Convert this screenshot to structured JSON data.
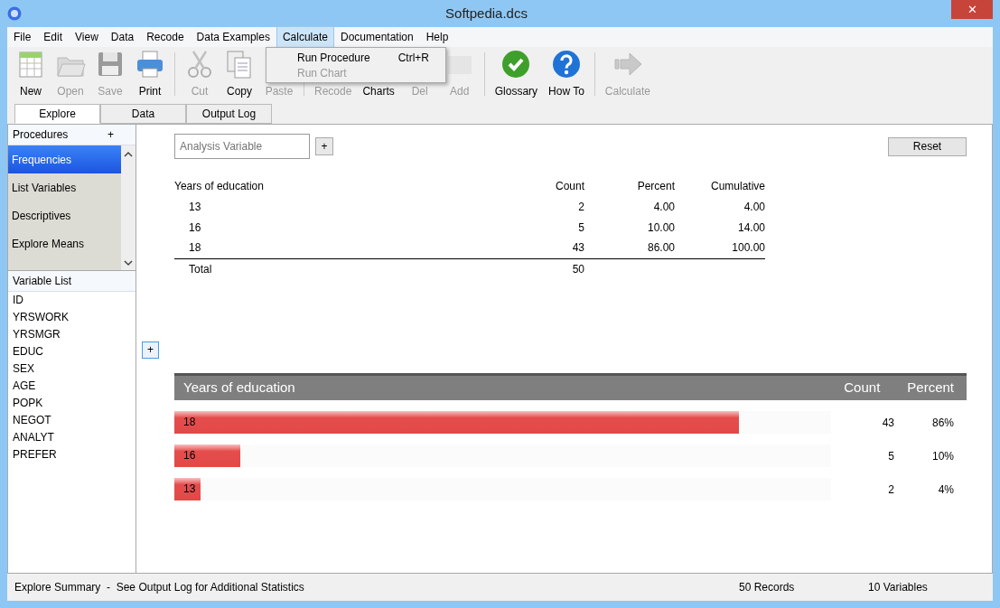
{
  "window": {
    "title": "Softpedia.dcs",
    "close": "✕"
  },
  "menu": [
    {
      "label": "File",
      "selected": false
    },
    {
      "label": "Edit",
      "selected": false
    },
    {
      "label": "View",
      "selected": false
    },
    {
      "label": "Data",
      "selected": false
    },
    {
      "label": "Recode",
      "selected": false
    },
    {
      "label": "Data Examples",
      "selected": false
    },
    {
      "label": "Calculate",
      "selected": true
    },
    {
      "label": "Documentation",
      "selected": false
    },
    {
      "label": "Help",
      "selected": false
    }
  ],
  "dropdown": [
    {
      "label": "Run Procedure",
      "shortcut": "Ctrl+R",
      "disabled": false
    },
    {
      "label": "Run Chart",
      "disabled": true
    }
  ],
  "toolbar": [
    [
      {
        "label": "New",
        "disabled": false
      },
      {
        "label": "Open",
        "disabled": true
      },
      {
        "label": "Save",
        "disabled": true
      },
      {
        "label": "Print",
        "disabled": false
      }
    ],
    [
      {
        "label": "Cut",
        "disabled": true
      },
      {
        "label": "Copy",
        "disabled": false
      },
      {
        "label": "Paste",
        "disabled": true
      }
    ],
    [
      {
        "label": "Recode",
        "disabled": true
      },
      {
        "label": "Charts",
        "disabled": false
      },
      {
        "label": "Del",
        "disabled": true
      },
      {
        "label": "Add",
        "disabled": true
      }
    ],
    [
      {
        "label": "Glossary",
        "disabled": false
      },
      {
        "label": "How To",
        "disabled": false
      }
    ],
    [
      {
        "label": "Calculate",
        "disabled": true
      }
    ]
  ],
  "tabs": [
    {
      "label": "Explore",
      "selected": true
    },
    {
      "label": "Data",
      "selected": false
    },
    {
      "label": "Output Log",
      "selected": false
    }
  ],
  "procedures": {
    "title": "Procedures",
    "add": "+",
    "items": [
      {
        "label": "Frequencies",
        "selected": true
      },
      {
        "label": "List Variables",
        "selected": false
      },
      {
        "label": "Descriptives",
        "selected": false
      },
      {
        "label": "Explore Means",
        "selected": false
      }
    ]
  },
  "variable_list": {
    "title": "Variable List",
    "items": [
      "ID",
      "YRSWORK",
      "YRSMGR",
      "EDUC",
      "SEX",
      "AGE",
      "POPK",
      "NEGOT",
      "ANALYT",
      "PREFER"
    ]
  },
  "analysis": {
    "placeholder": "Analysis Variable",
    "add": "+",
    "reset": "Reset",
    "chart_add": "+"
  },
  "table": {
    "columns": [
      "Years of education",
      "Count",
      "Percent",
      "Cumulative"
    ],
    "rows": [
      [
        "13",
        "2",
        "4.00",
        "4.00"
      ],
      [
        "16",
        "5",
        "10.00",
        "14.00"
      ],
      [
        "18",
        "43",
        "86.00",
        "100.00"
      ]
    ],
    "total": [
      "Total",
      "50"
    ]
  },
  "bar_list": {
    "columns": [
      "Years of education",
      "Count",
      "Percent"
    ],
    "rows": [
      {
        "label": "18",
        "level": 0.86,
        "count": "43",
        "percent": "86%"
      },
      {
        "label": "16",
        "level": 0.1,
        "count": "5",
        "percent": "10%"
      },
      {
        "label": "13",
        "level": 0.04,
        "count": "2",
        "percent": "4%"
      }
    ]
  },
  "status_bar": {
    "summary": "Explore Summary  -  See Output Log for Additional Statistics",
    "records": "50 Records",
    "variables": "10 Variables"
  }
}
